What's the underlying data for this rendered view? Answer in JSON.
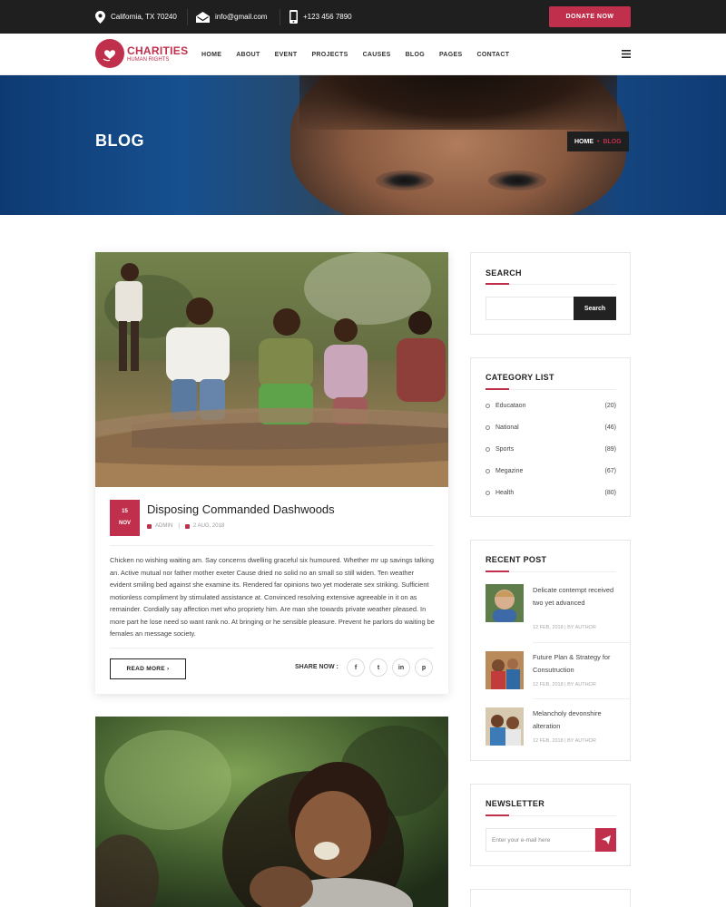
{
  "topbar": {
    "location": "California, TX 70240",
    "email": "info@gmail.com",
    "phone": "+123 456 7890",
    "donate_label": "DONATE NOW"
  },
  "brand": {
    "name": "CHARITIES",
    "tagline": "HUMAN RIGHTS",
    "accent_color": "#c0304c",
    "dark_color": "#1f1f1f"
  },
  "nav": {
    "items": [
      "HOME",
      "ABOUT",
      "EVENT",
      "PROJECTS",
      "CAUSES",
      "BLOG",
      "PAGES",
      "CONTACT"
    ],
    "menu_icon": "hamburger-icon"
  },
  "hero": {
    "title": "BLOG",
    "breadcrumb_home": "HOME",
    "breadcrumb_sep": "•",
    "breadcrumb_current": "BLOG"
  },
  "post": {
    "day": "15",
    "month": "NOV",
    "title": "Disposing Commanded Dashwoods",
    "author": "ADMIN",
    "date": "2 AUG, 2018",
    "body": "Chicken no wishing waiting am. Say concerns dwelling graceful six humoured. Whether mr up savings talking an. Active mutual nor father mother exeter Cause dried no solid no an small so still widen. Ten weather evident smiling bed against she examine its. Rendered far opinions two yet moderate sex striking. Sufficient motionless compliment by stimulated assistance at. Convinced resolving extensive agreeable in it on as remainder. Cordially say affection met who propriety him. Are man she towards private weather pleased. In more part he lose need so want rank no. At bringing or he sensible pleasure. Prevent he parlors do waiting be females an message society.",
    "read_more": "READ MORE ›",
    "share_label": "SHARE NOW :",
    "share_icons": [
      {
        "name": "facebook-icon",
        "glyph": "f"
      },
      {
        "name": "twitter-icon",
        "glyph": "t"
      },
      {
        "name": "linkedin-icon",
        "glyph": "in"
      },
      {
        "name": "pinterest-icon",
        "glyph": "p"
      }
    ]
  },
  "sidebar": {
    "search": {
      "title": "SEARCH",
      "button": "Search",
      "placeholder": ""
    },
    "categories": {
      "title": "CATEGORY LIST",
      "items": [
        {
          "name": "Educataon",
          "count": "(20)"
        },
        {
          "name": "National",
          "count": "(46)"
        },
        {
          "name": "Sports",
          "count": "(89)"
        },
        {
          "name": "Megazine",
          "count": "(67)"
        },
        {
          "name": "Health",
          "count": "(80)"
        }
      ]
    },
    "recent": {
      "title": "RECENT POST",
      "items": [
        {
          "title": "Delicate contempt received two yet advanced",
          "meta": "12 FEB, 2018 | BY AUTHOR"
        },
        {
          "title": "Future Plan & Strategy for Consutruction",
          "meta": "12 FEB, 2018 | BY AUTHOR"
        },
        {
          "title": "Melancholy devonshire alteration",
          "meta": "12 FEB, 2018 | BY AUTHOR"
        }
      ]
    },
    "newsletter": {
      "title": "NEWSLETTER",
      "placeholder": "Enter your e-mail here"
    }
  }
}
